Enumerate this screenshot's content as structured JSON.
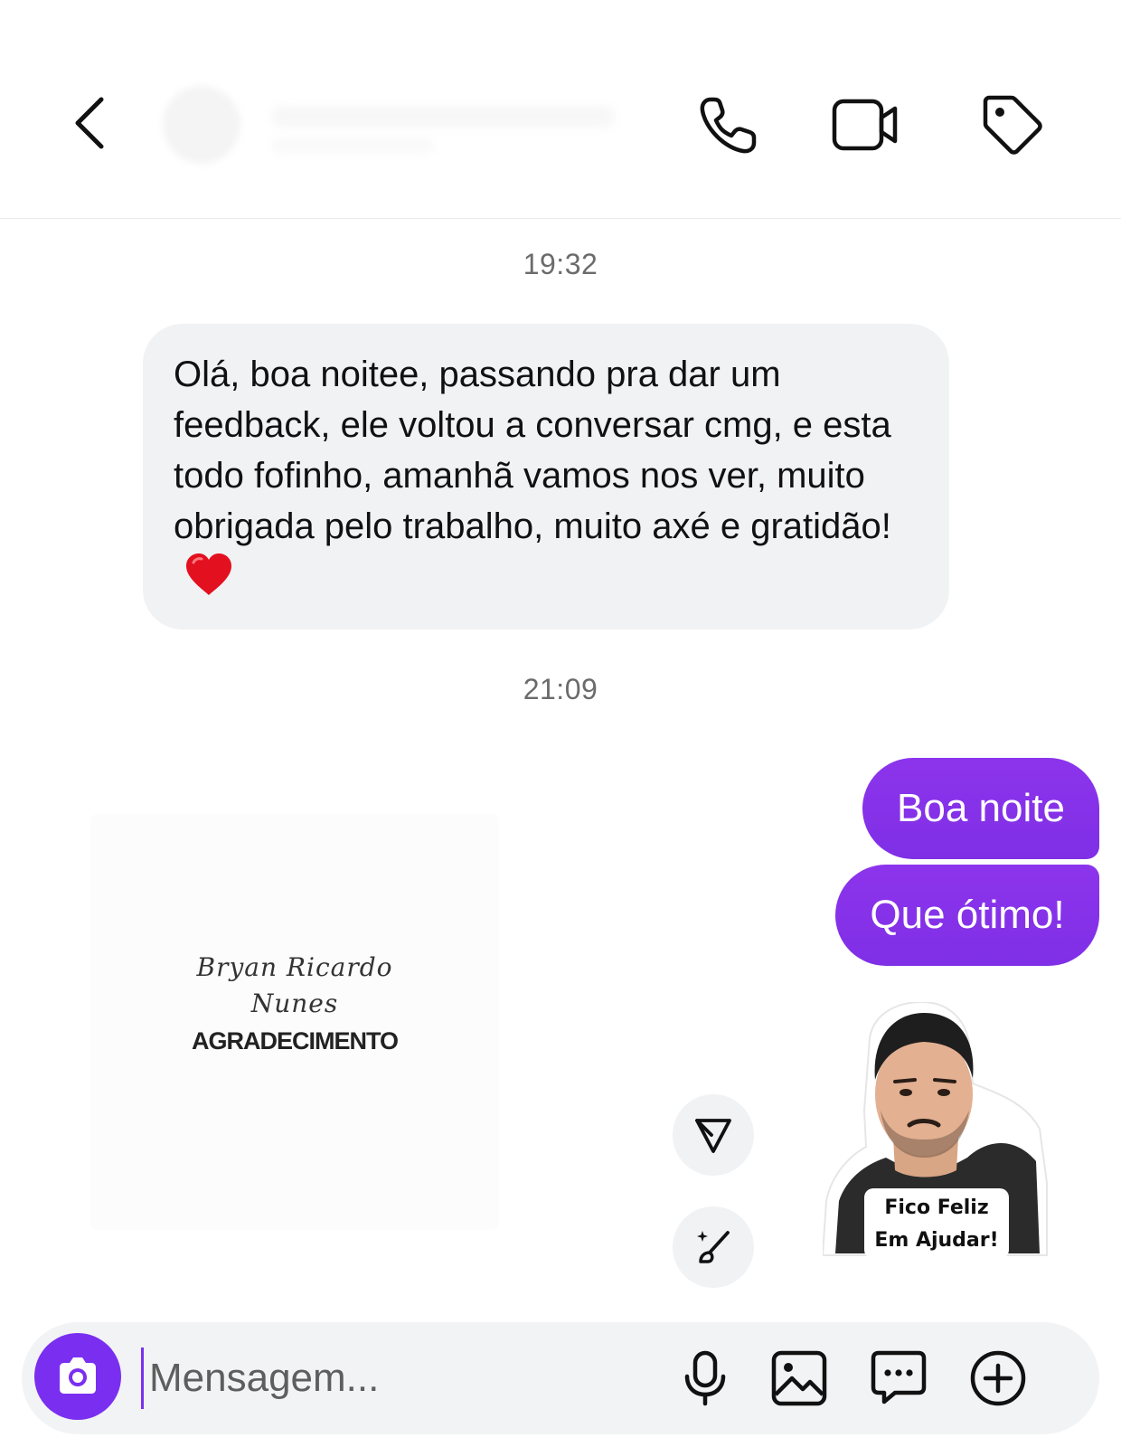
{
  "header": {
    "icons": [
      "back-arrow-icon",
      "phone-icon",
      "video-camera-icon",
      "tag-icon"
    ]
  },
  "messages": {
    "time_1": "19:32",
    "incoming_text": "Olá, boa noitee, passando pra dar um feedback, ele voltou a conversar cmg, e esta todo fofinho, amanhã vamos nos ver, muito obrigada pelo trabalho, muito axé e gratidão!",
    "time_2": "21:09",
    "outgoing_1": "Boa noite",
    "outgoing_2": "Que ótimo!"
  },
  "shared_post": {
    "signature_line_1": "Bryan Ricardo",
    "signature_line_2": "Nunes",
    "title": "AGRADECIMENTO"
  },
  "sticker": {
    "caption_line_1": "Fico Feliz",
    "caption_line_2": "Em Ajudar!"
  },
  "composer": {
    "placeholder": "Mensagem...",
    "icons": [
      "camera-icon",
      "microphone-icon",
      "gallery-icon",
      "sticker-chat-icon",
      "plus-icon"
    ]
  },
  "colors": {
    "accent": "#7a2ff0",
    "outgoing_bubble": "#8a33ea",
    "incoming_bubble": "#f1f2f4"
  }
}
